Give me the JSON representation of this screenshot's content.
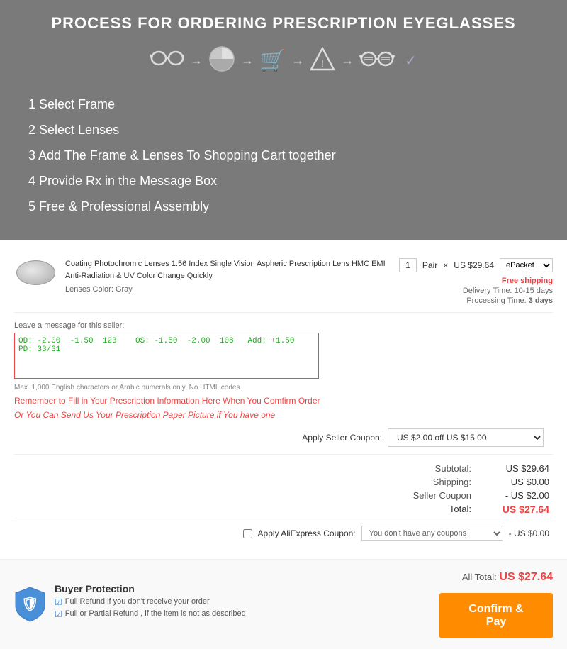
{
  "header": {
    "title": "PROCESS FOR ORDERING PRESCRIPTION EYEGLASSES",
    "steps": [
      "1 Select Frame",
      "2 Select Lenses",
      "3 Add The Frame & Lenses To Shopping Cart together",
      "4 Provide Rx in the Message Box",
      "5 Free & Professional Assembly"
    ]
  },
  "product": {
    "name": "Coating Photochromic Lenses 1.56 Index Single Vision Aspheric Prescription Lens HMC EMI Anti-Radiation & UV Color Change Quickly",
    "color_label": "Lenses Color:",
    "color_value": "Gray",
    "quantity": "1",
    "unit": "Pair",
    "price": "US $29.64",
    "shipping_option": "ePacket",
    "free_shipping": "Free shipping",
    "delivery_label": "Delivery Time:",
    "delivery_value": "10-15 days",
    "processing_label": "Processing Time:",
    "processing_value": "3 days"
  },
  "message_box": {
    "label": "Leave a message for this seller:",
    "content": "OD: -2.00  -1.50  123    OS: -1.50  -2.00  108   Add: +1.50  PD: 33/31",
    "hint": "Max. 1,000 English characters or Arabic numerals only. No HTML codes.",
    "reminder": "Remember to Fill in Your Prescription Information Here When You Comfirm Order",
    "optional": "Or You Can Send Us Your Prescription Paper Picture if You have one"
  },
  "coupon": {
    "label": "Apply Seller Coupon:",
    "value": "US $2.00 off US $15.00",
    "dropdown_icon": "▼"
  },
  "price_summary": {
    "subtotal_label": "Subtotal:",
    "subtotal_value": "US $29.64",
    "shipping_label": "Shipping:",
    "shipping_value": "US $0.00",
    "seller_coupon_label": "Seller Coupon",
    "seller_coupon_value": "- US $2.00",
    "total_label": "Total:",
    "total_value": "US $27.64"
  },
  "ali_coupon": {
    "checkbox_label": "Apply AliExpress Coupon:",
    "placeholder": "You don't have any coupons",
    "value": "- US $0.00"
  },
  "footer": {
    "buyer_protection_title": "Buyer Protection",
    "protection_1": "Full Refund if you don't receive your order",
    "protection_2": "Full or Partial Refund , if the item is not as described",
    "all_total_label": "All Total:",
    "all_total_value": "US $27.64",
    "confirm_button": "Confirm & Pay"
  }
}
